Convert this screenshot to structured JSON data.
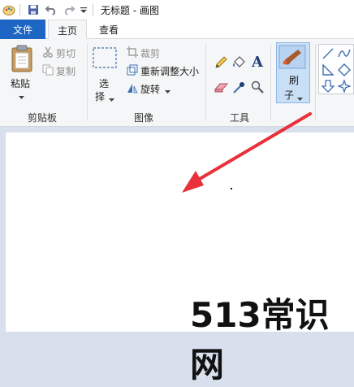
{
  "window": {
    "title": "无标题 - 画图"
  },
  "tabs": {
    "file": "文件",
    "home": "主页",
    "view": "查看"
  },
  "clipboard": {
    "paste": "粘贴",
    "cut": "剪切",
    "copy": "复制",
    "group": "剪贴板"
  },
  "image": {
    "select_line1": "选",
    "select_line2": "择",
    "crop": "裁剪",
    "resize": "重新调整大小",
    "rotate": "旋转",
    "group": "图像"
  },
  "tools": {
    "group": "工具",
    "text_tool": "A"
  },
  "brush": {
    "line1": "刷",
    "line2": "子"
  },
  "watermark": "513常识网",
  "colors": {
    "file_tab": "#1e66c4",
    "arrow": "#e8313a",
    "accent": "#2b6cc4"
  }
}
